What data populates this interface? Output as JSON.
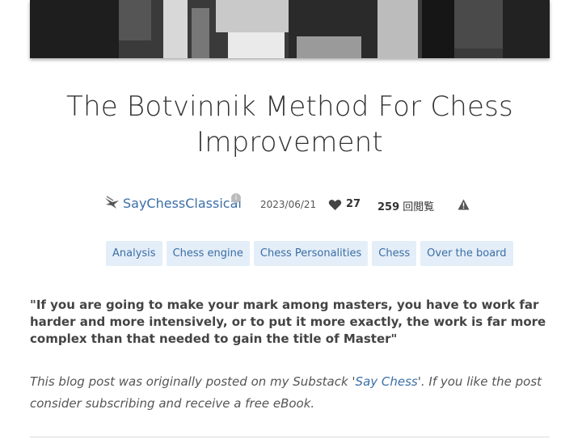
{
  "post": {
    "title": "The Botvinnik Method For Chess Improvement",
    "author": "SayChessClassical",
    "date": "2023/06/21",
    "likes": "27",
    "views_count": "259",
    "views_suffix": " 回閲覧",
    "tags": [
      "Analysis",
      "Chess engine",
      "Chess Personalities",
      "Chess",
      "Over the board"
    ],
    "quote": "\"If you are going to make your mark among masters, you have to work far harder and more intensively, or to put it more exactly, the work is far more complex than that needed to gain the title of Master\"",
    "note_before": "This blog post was originally posted on my Substack '",
    "note_link": "Say Chess",
    "note_after": "'. If you like the post consider subscribing and receive a free eBook."
  },
  "icons": {
    "author": "bird-icon",
    "info": "info-icon",
    "like": "heart-icon",
    "report": "warning-icon"
  },
  "colors": {
    "link": "#3b6ea5",
    "tag_bg": "#e4eef8"
  }
}
